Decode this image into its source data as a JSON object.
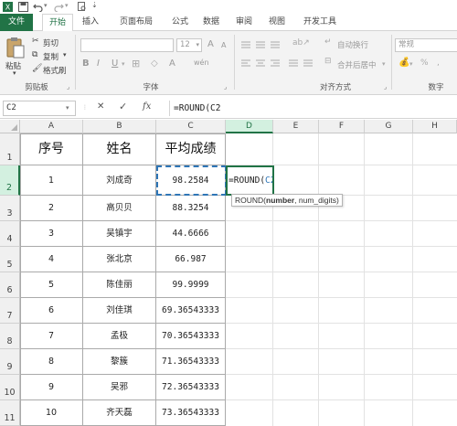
{
  "qat": {
    "icons": [
      "excel-logo-icon",
      "save-icon",
      "undo-icon",
      "redo-icon",
      "print-preview-icon",
      "customize-icon"
    ]
  },
  "tabs": [
    "文件",
    "开始",
    "插入",
    "页面布局",
    "公式",
    "数据",
    "审阅",
    "视图",
    "开发工具"
  ],
  "ribbon": {
    "clipboard": {
      "paste": "粘贴",
      "cut": "剪切",
      "copy": "复制",
      "format_painter": "格式刷",
      "label": "剪贴板"
    },
    "font": {
      "size": "12",
      "increase": "A",
      "decrease": "A",
      "bold": "B",
      "italic": "I",
      "underline": "U",
      "font_color": "A",
      "wen": "wén",
      "label": "字体"
    },
    "alignment": {
      "wrap_text": "自动换行",
      "merge_center": "合并后居中",
      "label": "对齐方式"
    },
    "number": {
      "format": "常规",
      "label": "数字"
    }
  },
  "formula_bar": {
    "name_box": "C2",
    "cancel": "✕",
    "enter": "✓",
    "fx": "fx",
    "formula": "=ROUND(C2"
  },
  "columns": [
    "A",
    "B",
    "C",
    "D",
    "E",
    "F",
    "G",
    "H"
  ],
  "rows": [
    "1",
    "2",
    "3",
    "4",
    "5",
    "6",
    "7",
    "8",
    "9",
    "10",
    "11"
  ],
  "table": {
    "headers": [
      "序号",
      "姓名",
      "平均成绩"
    ],
    "rows": [
      [
        "1",
        "刘成奇",
        "98.2584"
      ],
      [
        "2",
        "高贝贝",
        "88.3254"
      ],
      [
        "3",
        "吴镇宇",
        "44.6666"
      ],
      [
        "4",
        "张北京",
        "66.987"
      ],
      [
        "5",
        "陈佳丽",
        "99.9999"
      ],
      [
        "6",
        "刘佳琪",
        "69.36543333"
      ],
      [
        "7",
        "孟极",
        "70.36543333"
      ],
      [
        "8",
        "黎簇",
        "71.36543333"
      ],
      [
        "9",
        "吴邪",
        "72.36543333"
      ],
      [
        "10",
        "齐天磊",
        "73.36543333"
      ]
    ]
  },
  "editing": {
    "text_prefix": "=ROUND(",
    "text_ref": "C2"
  },
  "tooltip": {
    "func": "ROUND(",
    "arg1": "number",
    "rest": ", num_digits)"
  },
  "colors": {
    "excel_green": "#217346",
    "ref_blue": "#2e75b6"
  }
}
